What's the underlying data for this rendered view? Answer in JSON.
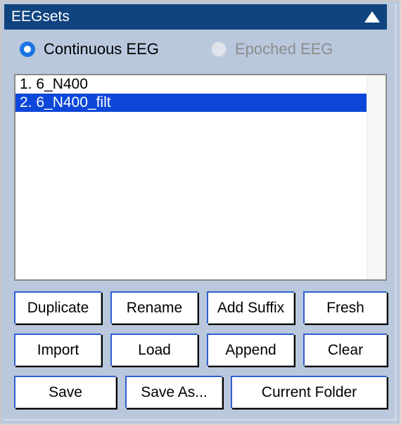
{
  "window": {
    "title": "EEGsets",
    "collapse_icon": "triangle-up-icon",
    "title_bar_color": "#104480",
    "background_color": "#b9c8dc"
  },
  "mode_selector": {
    "options": [
      {
        "label": "Continuous EEG",
        "selected": true,
        "enabled": true,
        "icon": "radio-selected-icon"
      },
      {
        "label": "Epoched EEG",
        "selected": false,
        "enabled": false,
        "icon": "radio-unselected-icon"
      }
    ],
    "selected_color": "#1b74e4",
    "disabled_text_color": "#8d8d8d"
  },
  "eegset_list": {
    "selection_color": "#0d47d9",
    "items": [
      {
        "label": "1. 6_N400",
        "selected": false
      },
      {
        "label": "2. 6_N400_filt",
        "selected": true
      }
    ]
  },
  "actions": {
    "row1": [
      {
        "label": "Duplicate"
      },
      {
        "label": "Rename"
      },
      {
        "label": "Add Suffix"
      },
      {
        "label": "Fresh"
      }
    ],
    "row2": [
      {
        "label": "Import"
      },
      {
        "label": "Load"
      },
      {
        "label": "Append"
      },
      {
        "label": "Clear"
      }
    ],
    "row3": [
      {
        "label": "Save"
      },
      {
        "label": "Save As..."
      },
      {
        "label": "Current Folder"
      }
    ],
    "button_border_color": "#2f5fd0"
  }
}
